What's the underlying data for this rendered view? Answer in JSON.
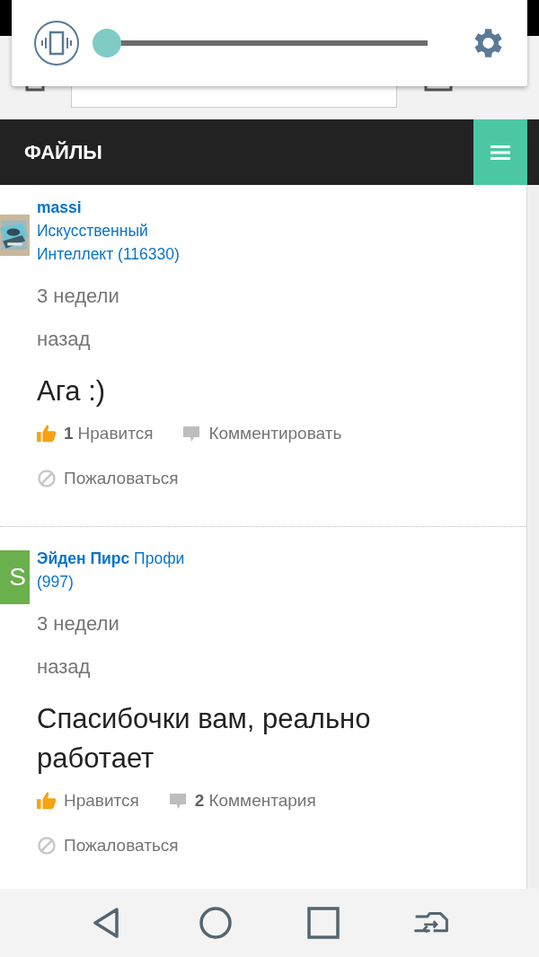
{
  "volume_popup": {
    "slider": {
      "level": 0
    }
  },
  "header": {
    "title": "ФАЙЛЫ"
  },
  "comments": [
    {
      "author": "massi",
      "rank": "Искусственный Интеллект",
      "score": "(116330)",
      "time": "3 недели назад",
      "text": "Ага :)",
      "likes": "1",
      "like_label": "Нравится",
      "comment_label": "Комментировать",
      "report_label": "Пожаловаться"
    },
    {
      "avatar": {
        "kind": "letter",
        "letter": "S",
        "color": "#6ab04c"
      },
      "author": "Эйден Пирс",
      "rank": "Профи",
      "score": "(997)",
      "time": "3 недели назад",
      "text": "Спасибочки вам, реально работает",
      "like_label": "Нравится",
      "comment_count": "2",
      "comment_label": "Комментария",
      "report_label": "Пожаловаться"
    }
  ]
}
